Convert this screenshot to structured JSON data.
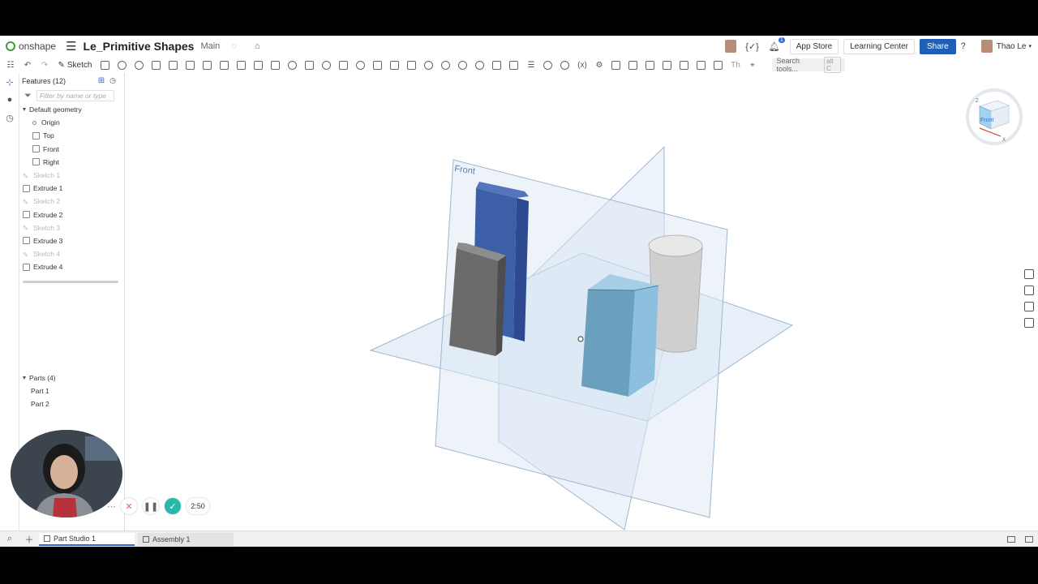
{
  "app": {
    "logo_text": "onshape",
    "doc_title": "Le_Primitive Shapes",
    "branch": "Main"
  },
  "top_right": {
    "code_label": "{✓}",
    "notification_count": "1",
    "app_store": "App Store",
    "learning_center": "Learning Center",
    "share": "Share",
    "help": "?",
    "user_name": "Thao Le"
  },
  "toolbar": {
    "sketch_label": "Sketch",
    "variables_label": "(x)",
    "text_label": "Th",
    "search_label": "Search tools...",
    "search_shortcut": "alt C"
  },
  "features": {
    "header": "Features (12)",
    "filter_placeholder": "Filter by name or type",
    "group": "Default geometry",
    "default_items": [
      "Origin",
      "Top",
      "Front",
      "Right"
    ],
    "items": [
      {
        "label": "Sketch 1",
        "dim": true
      },
      {
        "label": "Extrude 1",
        "dim": false
      },
      {
        "label": "Sketch 2",
        "dim": true
      },
      {
        "label": "Extrude 2",
        "dim": false
      },
      {
        "label": "Sketch 3",
        "dim": true
      },
      {
        "label": "Extrude 3",
        "dim": false
      },
      {
        "label": "Sketch 4",
        "dim": true
      },
      {
        "label": "Extrude 4",
        "dim": false
      }
    ]
  },
  "parts": {
    "header": "Parts (4)",
    "items": [
      "Part 1",
      "Part 2"
    ]
  },
  "viewport": {
    "plane_label": "Front",
    "viewcube_face": "Front",
    "axis_z": "Z",
    "axis_x": "X"
  },
  "recording": {
    "timer": "2:50"
  },
  "tabs": {
    "part_studio": "Part Studio 1",
    "assembly": "Assembly 1"
  },
  "colors": {
    "accent": "#1f5fb7",
    "plane": "#d4e4f3",
    "blue_part": "#3d5fa8",
    "gray_part": "#6b6b6b",
    "cube_part": "#7fb0d0",
    "cylinder_part": "#d8d8d8"
  }
}
